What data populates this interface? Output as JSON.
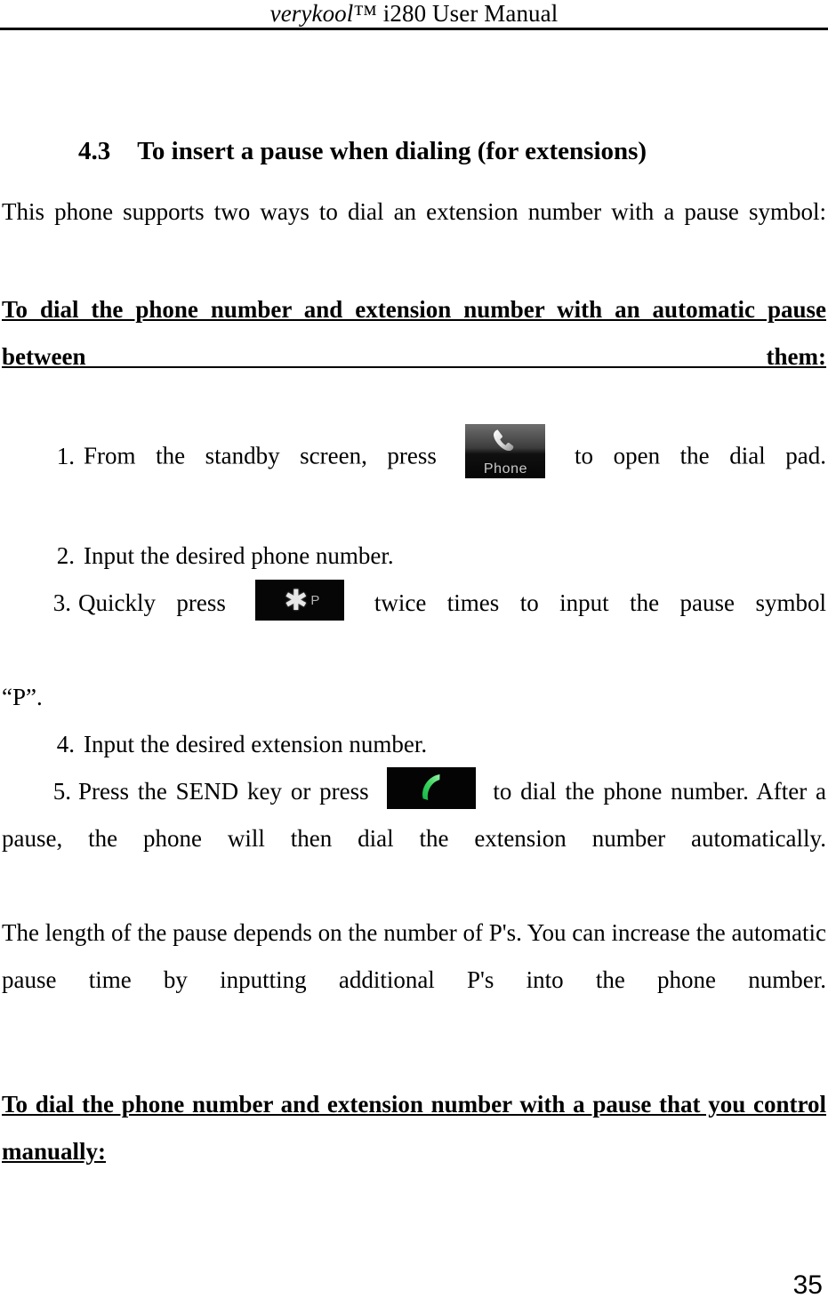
{
  "header": {
    "brand": "verykool",
    "trademark": "™",
    "model_and_doc": " i280 User Manual"
  },
  "section": {
    "number": "4.3",
    "title": "To insert a pause when dialing (for extensions)"
  },
  "intro_paragraph": "This phone supports two ways to dial an extension number with a pause symbol:",
  "subheading_1": "To dial the phone number and extension number with an automatic pause between them:",
  "steps": [
    {
      "number": "1.",
      "text_before": "From the standby screen, press",
      "icon": "phone-app-icon",
      "icon_label": "Phone",
      "text_after": "to open the dial pad."
    },
    {
      "number": "2.",
      "text_before": "Input the desired phone number.",
      "icon": null,
      "icon_label": "",
      "text_after": ""
    },
    {
      "number": "3.",
      "text_before": "Quickly press",
      "icon": "star-pause-key-icon",
      "icon_label": "*P",
      "text_after": "twice times to input the pause symbol",
      "continuation": "“P”."
    },
    {
      "number": "4.",
      "text_before": "Input the desired extension number.",
      "icon": null,
      "icon_label": "",
      "text_after": ""
    },
    {
      "number": "5.",
      "text_before": "Press the SEND key or press",
      "icon": "green-call-key-icon",
      "icon_label": "",
      "text_after": "to dial the phone number. After a pause, the phone will then dial the extension number automatically."
    }
  ],
  "pause_length_paragraph": "The length of the pause depends on the number of P's. You can increase the automatic pause time by inputting additional P's into the phone number.",
  "subheading_2": "To dial the phone number and extension number with a pause that you control manually:",
  "page_number": "35",
  "colors": {
    "text": "#000000",
    "background": "#ffffff",
    "rule": "#000000",
    "icon_dark": "#060606",
    "icon_label": "#c9c9c9",
    "call_green": "#3ed45f"
  }
}
